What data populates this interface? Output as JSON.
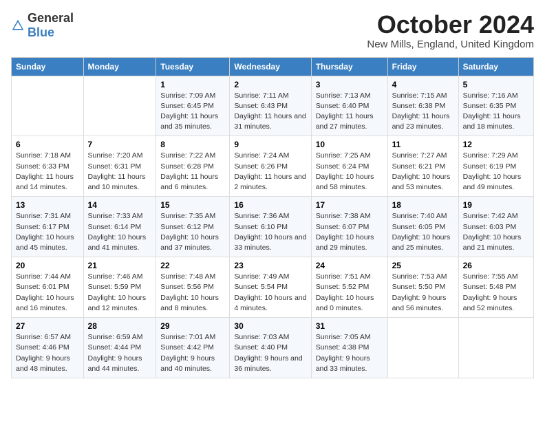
{
  "header": {
    "logo_general": "General",
    "logo_blue": "Blue",
    "month": "October 2024",
    "location": "New Mills, England, United Kingdom"
  },
  "weekdays": [
    "Sunday",
    "Monday",
    "Tuesday",
    "Wednesday",
    "Thursday",
    "Friday",
    "Saturday"
  ],
  "weeks": [
    [
      {
        "day": "",
        "info": ""
      },
      {
        "day": "",
        "info": ""
      },
      {
        "day": "1",
        "info": "Sunrise: 7:09 AM\nSunset: 6:45 PM\nDaylight: 11 hours and 35 minutes."
      },
      {
        "day": "2",
        "info": "Sunrise: 7:11 AM\nSunset: 6:43 PM\nDaylight: 11 hours and 31 minutes."
      },
      {
        "day": "3",
        "info": "Sunrise: 7:13 AM\nSunset: 6:40 PM\nDaylight: 11 hours and 27 minutes."
      },
      {
        "day": "4",
        "info": "Sunrise: 7:15 AM\nSunset: 6:38 PM\nDaylight: 11 hours and 23 minutes."
      },
      {
        "day": "5",
        "info": "Sunrise: 7:16 AM\nSunset: 6:35 PM\nDaylight: 11 hours and 18 minutes."
      }
    ],
    [
      {
        "day": "6",
        "info": "Sunrise: 7:18 AM\nSunset: 6:33 PM\nDaylight: 11 hours and 14 minutes."
      },
      {
        "day": "7",
        "info": "Sunrise: 7:20 AM\nSunset: 6:31 PM\nDaylight: 11 hours and 10 minutes."
      },
      {
        "day": "8",
        "info": "Sunrise: 7:22 AM\nSunset: 6:28 PM\nDaylight: 11 hours and 6 minutes."
      },
      {
        "day": "9",
        "info": "Sunrise: 7:24 AM\nSunset: 6:26 PM\nDaylight: 11 hours and 2 minutes."
      },
      {
        "day": "10",
        "info": "Sunrise: 7:25 AM\nSunset: 6:24 PM\nDaylight: 10 hours and 58 minutes."
      },
      {
        "day": "11",
        "info": "Sunrise: 7:27 AM\nSunset: 6:21 PM\nDaylight: 10 hours and 53 minutes."
      },
      {
        "day": "12",
        "info": "Sunrise: 7:29 AM\nSunset: 6:19 PM\nDaylight: 10 hours and 49 minutes."
      }
    ],
    [
      {
        "day": "13",
        "info": "Sunrise: 7:31 AM\nSunset: 6:17 PM\nDaylight: 10 hours and 45 minutes."
      },
      {
        "day": "14",
        "info": "Sunrise: 7:33 AM\nSunset: 6:14 PM\nDaylight: 10 hours and 41 minutes."
      },
      {
        "day": "15",
        "info": "Sunrise: 7:35 AM\nSunset: 6:12 PM\nDaylight: 10 hours and 37 minutes."
      },
      {
        "day": "16",
        "info": "Sunrise: 7:36 AM\nSunset: 6:10 PM\nDaylight: 10 hours and 33 minutes."
      },
      {
        "day": "17",
        "info": "Sunrise: 7:38 AM\nSunset: 6:07 PM\nDaylight: 10 hours and 29 minutes."
      },
      {
        "day": "18",
        "info": "Sunrise: 7:40 AM\nSunset: 6:05 PM\nDaylight: 10 hours and 25 minutes."
      },
      {
        "day": "19",
        "info": "Sunrise: 7:42 AM\nSunset: 6:03 PM\nDaylight: 10 hours and 21 minutes."
      }
    ],
    [
      {
        "day": "20",
        "info": "Sunrise: 7:44 AM\nSunset: 6:01 PM\nDaylight: 10 hours and 16 minutes."
      },
      {
        "day": "21",
        "info": "Sunrise: 7:46 AM\nSunset: 5:59 PM\nDaylight: 10 hours and 12 minutes."
      },
      {
        "day": "22",
        "info": "Sunrise: 7:48 AM\nSunset: 5:56 PM\nDaylight: 10 hours and 8 minutes."
      },
      {
        "day": "23",
        "info": "Sunrise: 7:49 AM\nSunset: 5:54 PM\nDaylight: 10 hours and 4 minutes."
      },
      {
        "day": "24",
        "info": "Sunrise: 7:51 AM\nSunset: 5:52 PM\nDaylight: 10 hours and 0 minutes."
      },
      {
        "day": "25",
        "info": "Sunrise: 7:53 AM\nSunset: 5:50 PM\nDaylight: 9 hours and 56 minutes."
      },
      {
        "day": "26",
        "info": "Sunrise: 7:55 AM\nSunset: 5:48 PM\nDaylight: 9 hours and 52 minutes."
      }
    ],
    [
      {
        "day": "27",
        "info": "Sunrise: 6:57 AM\nSunset: 4:46 PM\nDaylight: 9 hours and 48 minutes."
      },
      {
        "day": "28",
        "info": "Sunrise: 6:59 AM\nSunset: 4:44 PM\nDaylight: 9 hours and 44 minutes."
      },
      {
        "day": "29",
        "info": "Sunrise: 7:01 AM\nSunset: 4:42 PM\nDaylight: 9 hours and 40 minutes."
      },
      {
        "day": "30",
        "info": "Sunrise: 7:03 AM\nSunset: 4:40 PM\nDaylight: 9 hours and 36 minutes."
      },
      {
        "day": "31",
        "info": "Sunrise: 7:05 AM\nSunset: 4:38 PM\nDaylight: 9 hours and 33 minutes."
      },
      {
        "day": "",
        "info": ""
      },
      {
        "day": "",
        "info": ""
      }
    ]
  ]
}
